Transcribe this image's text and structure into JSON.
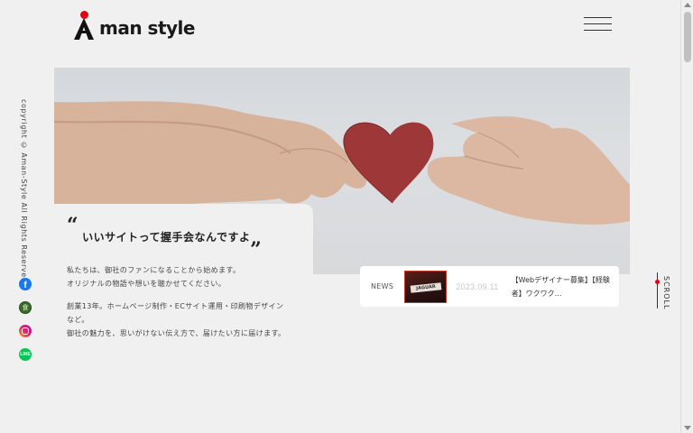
{
  "header": {
    "logo_text": "man style",
    "logo_accent_color": "#e60012"
  },
  "sidebar": {
    "copyright": "copyright © Aman-Style All Rights Reserved.",
    "social": [
      {
        "name": "facebook-icon",
        "glyph": "f"
      },
      {
        "name": "tabelog-icon",
        "glyph": "食"
      },
      {
        "name": "instagram-icon",
        "glyph": ""
      },
      {
        "name": "line-icon",
        "glyph": "LINE"
      }
    ]
  },
  "intro": {
    "headline": "いいサイトって握手会なんですよ",
    "open_quote": "“",
    "close_quote": "„",
    "para1_line1": "私たちは、御社のファンになることから始めます。",
    "para1_line2": "オリジナルの物語や想いを聴かせてください。",
    "para2_line1": "創業13年。ホームページ制作・ECサイト運用・印刷物デザイン",
    "para2_line2": "など。",
    "para2_line3": "御社の魅力を、思いがけない伝え方で、届けたい方に届けます。"
  },
  "news": {
    "label": "NEWS",
    "date": "2023.09.11",
    "title": "【Webデザイナー募集】【経験者】ワクワク…",
    "thumb_text": "JAGUAR"
  },
  "scroll": {
    "label": "SCROLL"
  }
}
